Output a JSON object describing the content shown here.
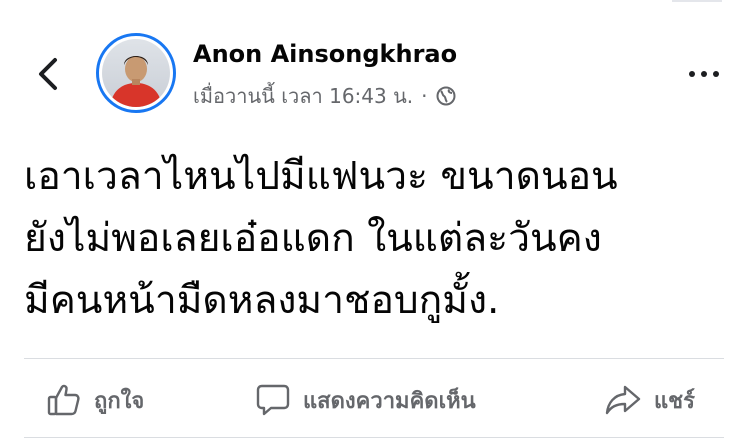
{
  "post": {
    "author": "Anon Ainsongkhrao",
    "timestamp": "เมื่อวานนี้ เวลา 16:43 น.",
    "separator": "·",
    "audience_icon": "globe-icon",
    "text_lines": [
      "เอาเวลาไหนไปมีแฟนวะ ขนาดนอน",
      "ยังไม่พอเลยเอ๋อแดก ในแต่ละวันคง",
      "มีคนหน้ามืดหลงมาชอบกูมั้ง."
    ]
  },
  "actions": {
    "like": {
      "label": "ถูกใจ",
      "icon": "thumbs-up-icon"
    },
    "comment": {
      "label": "แสดงความคิดเห็น",
      "icon": "comment-bubble-icon"
    },
    "share": {
      "label": "แชร์",
      "icon": "share-arrow-icon"
    }
  },
  "header": {
    "back_icon": "chevron-left-icon",
    "more_icon": "more-options-icon"
  },
  "colors": {
    "accent": "#1877f2",
    "text_primary": "#050505",
    "text_secondary": "#65676b",
    "divider": "#dadde1"
  }
}
